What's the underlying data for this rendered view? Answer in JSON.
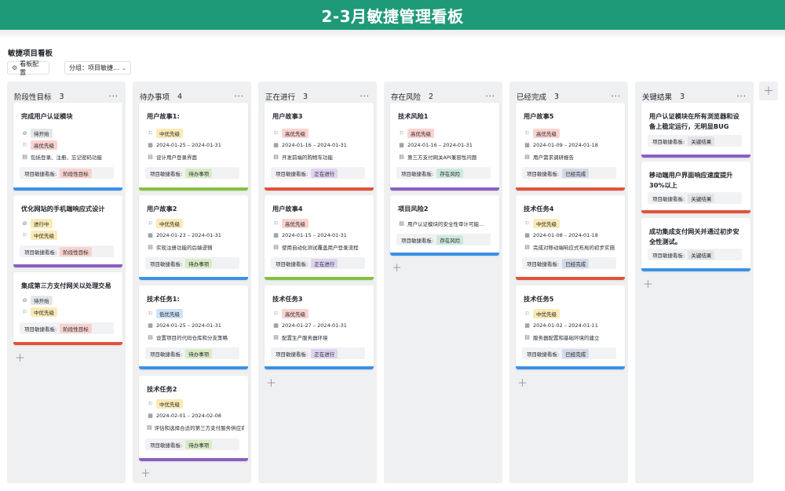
{
  "header": {
    "title": "2-3月敏捷管理看板"
  },
  "board": {
    "name": "敏捷项目看板",
    "config_label": "看板配置",
    "group_label": "分组：项目敏捷..."
  },
  "icons": {
    "config": "gear-icon",
    "group": "chevron-down-icon",
    "status": "check-circle-icon",
    "priority": "flag-icon",
    "date": "calendar-icon",
    "desc": "document-icon",
    "more": "more-icon",
    "add": "plus-icon"
  },
  "colors": {
    "header": "#1e9a79",
    "blue": "#3b91e6",
    "purple": "#8b5fbf",
    "red": "#e0533a",
    "green": "#84c23f"
  },
  "board_field_label": "项目敏捷看板:",
  "columns": [
    {
      "title": "阶段性目标",
      "count": "3",
      "cards": [
        {
          "title": "完成用户认证模块",
          "status": "待开始",
          "priority": "高优先级",
          "desc": "包括登录、注册、忘记密码功能",
          "board_tag": "阶段性目标"
        },
        {
          "title": "优化网站的手机端响应式设计",
          "status": "进行中",
          "priority": "中优先级",
          "board_tag": "阶段性目标"
        },
        {
          "title": "集成第三方支付网关以处理交易",
          "status": "待开始",
          "priority": "中优先级",
          "board_tag": "阶段性目标"
        }
      ]
    },
    {
      "title": "待办事项",
      "count": "4",
      "cards": [
        {
          "title": "用户故事1:",
          "priority": "中优先级",
          "date": "2024-01-25 – 2024-01-31",
          "desc": "设计用户登录界面",
          "board_tag": "待办事项"
        },
        {
          "title": "用户故事2",
          "priority": "中优先级",
          "date": "2024-01-23 – 2024-01-31",
          "desc": "实现注册功能的后端逻辑",
          "board_tag": "待办事项"
        },
        {
          "title": "技术任务1:",
          "priority": "低优先级",
          "date": "2024-01-25 – 2024-01-31",
          "desc": "设置项目的代码仓库和分支策略",
          "board_tag": "待办事项"
        },
        {
          "title": "技术任务2",
          "priority": "中优先级",
          "date": "2024-02-01 – 2024-02-08",
          "desc": "评估和选择合适的第三方支付服务供应商",
          "board_tag": "待办事项"
        }
      ]
    },
    {
      "title": "正在进行",
      "count": "3",
      "cards": [
        {
          "title": "用户故事3",
          "priority": "高优先级",
          "date": "2024-01-16 – 2024-01-31",
          "desc": "开发前端的购物车功能",
          "board_tag": "正在进行"
        },
        {
          "title": "用户故事4",
          "priority": "高优先级",
          "date": "2024-01-15 – 2024-01-31",
          "desc": "使用自动化测试覆盖用户登录流程",
          "board_tag": "正在进行"
        },
        {
          "title": "技术任务3",
          "priority": "高优先级",
          "date": "2024-01-27 – 2024-01-31",
          "desc": "配置生产服务器环境",
          "board_tag": "正在进行"
        }
      ]
    },
    {
      "title": "存在风险",
      "count": "2",
      "cards": [
        {
          "title": "技术风险1",
          "priority": "高优先级",
          "date": "2024-01-16 – 2024-01-31",
          "desc": "第三方支付网关API兼容性问题",
          "board_tag": "存在风险"
        },
        {
          "title": "项目风险2",
          "desc": "用户认证模块的安全性审计可能...",
          "board_tag": "存在风险"
        }
      ]
    },
    {
      "title": "已经完成",
      "count": "3",
      "cards": [
        {
          "title": "用户故事5",
          "priority": "高优先级",
          "date": "2024-01-09 – 2024-01-18",
          "desc": "用户需求调研报告",
          "board_tag": "已经完成"
        },
        {
          "title": "技术任务4",
          "priority": "中优先级",
          "date": "2024-01-08 – 2024-01-18",
          "desc": "完成对移动端响应式布局的初步实施",
          "board_tag": "已经完成"
        },
        {
          "title": "技术任务5",
          "priority": "中优先级",
          "date": "2024-01-02 – 2024-01-11",
          "desc": "服务器配置和基础环境的建立",
          "board_tag": "已经完成"
        }
      ]
    },
    {
      "title": "关键结果",
      "count": "3",
      "cards": [
        {
          "title": "用户认证模块在所有浏览器和设备上稳定运行，无明显BUG",
          "board_tag": "关键结果"
        },
        {
          "title": "移动端用户界面响应速度提升30%以上",
          "board_tag": "关键结果"
        },
        {
          "title": "成功集成支付网关并通过初步安全性测试。",
          "board_tag": "关键结果"
        }
      ]
    }
  ]
}
